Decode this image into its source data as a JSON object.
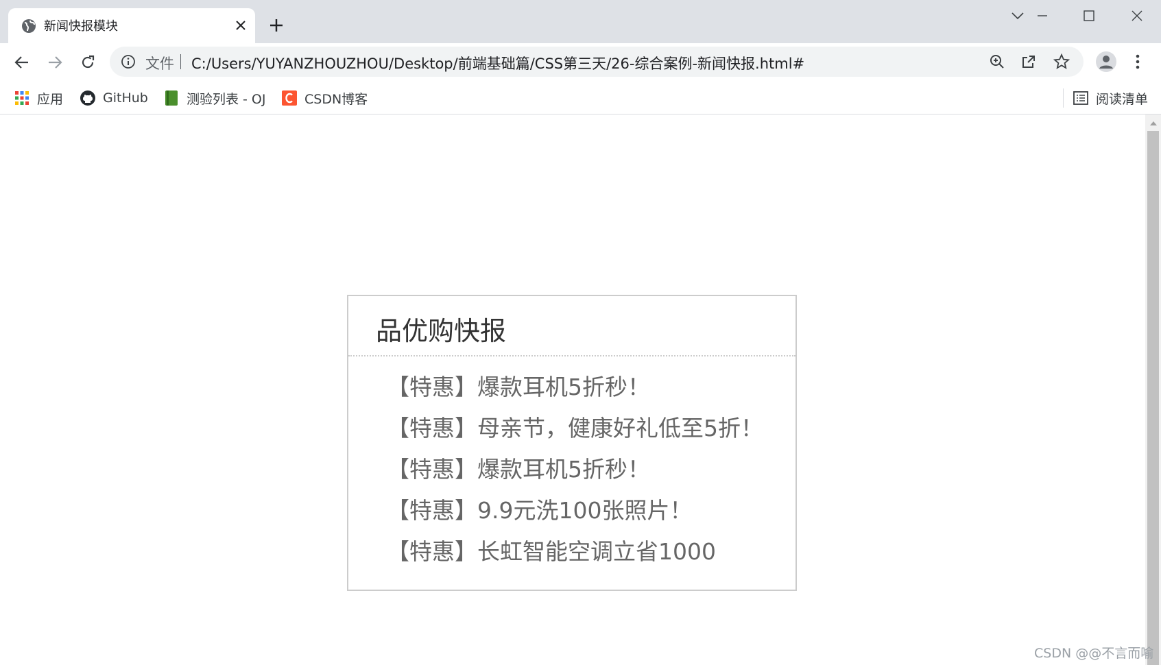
{
  "browser": {
    "tab": {
      "title": "新闻快报模块",
      "favicon": "globe-icon"
    },
    "window_controls": [
      "chevron-down-icon",
      "minimize-icon",
      "maximize-icon",
      "close-icon"
    ],
    "omnibox": {
      "chip": "文件",
      "url": "C:/Users/YUYANZHOUZHOU/Desktop/前端基础篇/CSS第三天/26-综合案例-新闻快报.html#"
    },
    "bookmarks": [
      {
        "label": "应用",
        "icon": "apps-grid-icon"
      },
      {
        "label": "GitHub",
        "icon": "github-icon"
      },
      {
        "label": "测验列表 - OJ",
        "icon": "book-icon"
      },
      {
        "label": "CSDN博客",
        "icon": "csdn-icon"
      }
    ],
    "reading_list": "阅读清单"
  },
  "page": {
    "news_title": "品优购快报",
    "news_items": [
      "【特惠】爆款耳机5折秒！",
      "【特惠】母亲节，健康好礼低至5折！",
      "【特惠】爆款耳机5折秒！",
      "【特惠】9.9元洗100张照片！",
      "【特惠】长虹智能空调立省1000"
    ]
  },
  "watermark": "CSDN @@不言而喻",
  "colors": {
    "tabstrip_bg": "#dee1e6",
    "omnibox_bg": "#f1f3f4",
    "box_border": "#cccccc",
    "title_text": "#333333",
    "item_text": "#666666"
  }
}
